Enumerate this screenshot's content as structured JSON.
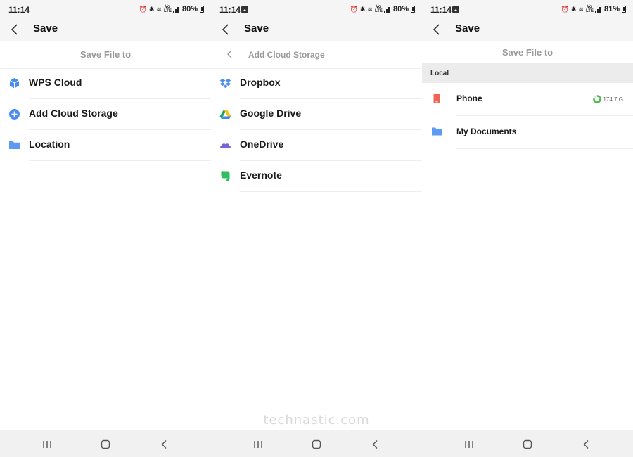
{
  "screens": [
    {
      "status": {
        "time": "11:14",
        "battery": "80%"
      },
      "header": {
        "title": "Save"
      },
      "subtitle": "Save File to",
      "items": [
        {
          "label": "WPS Cloud",
          "icon": "wps-cloud-icon"
        },
        {
          "label": "Add Cloud Storage",
          "icon": "add-icon"
        },
        {
          "label": "Location",
          "icon": "folder-icon"
        }
      ]
    },
    {
      "status": {
        "time": "11:14",
        "battery": "80%"
      },
      "header": {
        "title": "Save"
      },
      "subtitle": "Add Cloud Storage",
      "items": [
        {
          "label": "Dropbox",
          "icon": "dropbox-icon"
        },
        {
          "label": "Google Drive",
          "icon": "google-drive-icon"
        },
        {
          "label": "OneDrive",
          "icon": "onedrive-icon"
        },
        {
          "label": "Evernote",
          "icon": "evernote-icon"
        }
      ]
    },
    {
      "status": {
        "time": "11:14",
        "battery": "81%"
      },
      "header": {
        "title": "Save"
      },
      "subtitle": "Save File to",
      "section": "Local",
      "items": [
        {
          "label": "Phone",
          "icon": "phone-icon",
          "storage": "174.7 G"
        },
        {
          "label": "My Documents",
          "icon": "folder-icon"
        }
      ]
    }
  ],
  "watermark": "technastic.com",
  "colors": {
    "accent_blue": "#4a8df0",
    "folder_blue": "#5b9af5",
    "phone_red": "#f06455",
    "evernote_green": "#2dbe60",
    "onedrive_purple": "#7b61d8",
    "storage_green": "#4cbb4c"
  }
}
